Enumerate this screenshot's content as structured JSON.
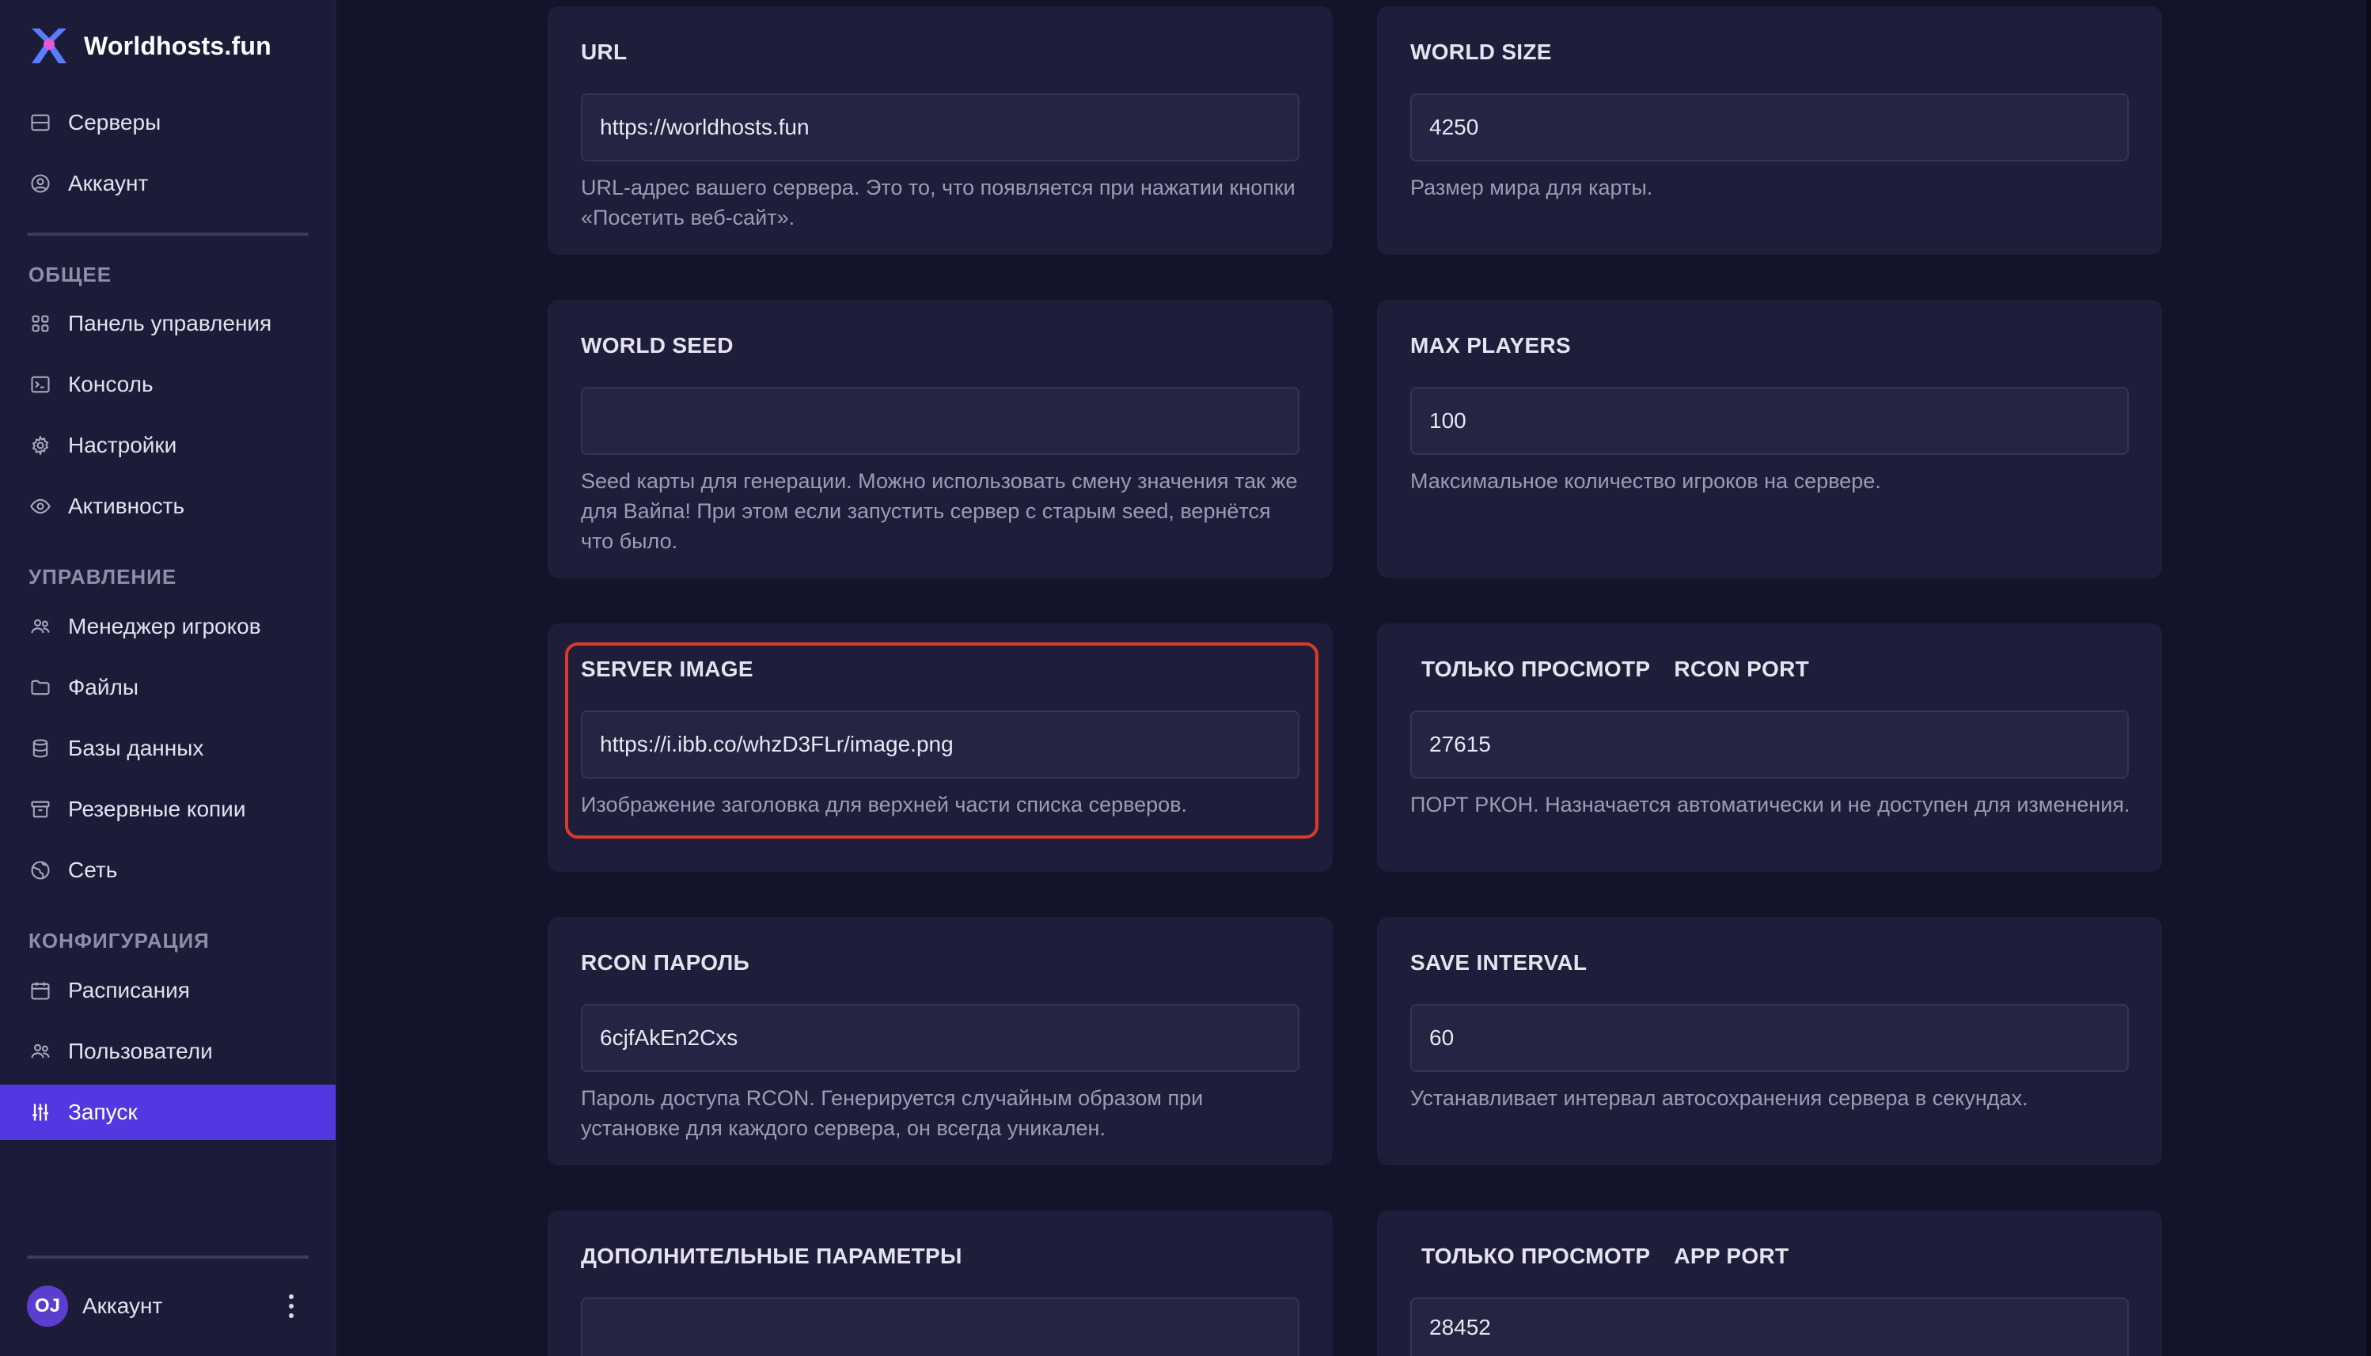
{
  "sidebar": {
    "brand": "Worldhosts.fun",
    "top_items": [
      {
        "label": "Серверы",
        "icon": "server-icon"
      },
      {
        "label": "Аккаунт",
        "icon": "user-circle-icon"
      }
    ],
    "sections": [
      {
        "title": "ОБЩЕЕ",
        "items": [
          {
            "label": "Панель управления",
            "icon": "grid-icon"
          },
          {
            "label": "Консоль",
            "icon": "terminal-icon"
          },
          {
            "label": "Настройки",
            "icon": "gear-icon"
          },
          {
            "label": "Активность",
            "icon": "eye-icon"
          }
        ]
      },
      {
        "title": "УПРАВЛЕНИЕ",
        "items": [
          {
            "label": "Менеджер игроков",
            "icon": "users-icon"
          },
          {
            "label": "Файлы",
            "icon": "folder-icon"
          },
          {
            "label": "Базы данных",
            "icon": "database-icon"
          },
          {
            "label": "Резервные копии",
            "icon": "archive-icon"
          },
          {
            "label": "Сеть",
            "icon": "globe-icon"
          }
        ]
      },
      {
        "title": "КОНФИГУРАЦИЯ",
        "items": [
          {
            "label": "Расписания",
            "icon": "calendar-icon"
          },
          {
            "label": "Пользователи",
            "icon": "users-icon"
          },
          {
            "label": "Запуск",
            "icon": "sliders-icon",
            "active": true
          }
        ]
      }
    ],
    "account": {
      "initials": "OJ",
      "label": "Аккаунт"
    }
  },
  "cards": {
    "url": {
      "title": "URL",
      "value": "https://worldhosts.fun",
      "help": "URL-адрес вашего сервера. Это то, что появляется при нажатии кнопки «Посетить веб-сайт»."
    },
    "world_size": {
      "title": "WORLD SIZE",
      "value": "4250",
      "help": "Размер мира для карты."
    },
    "world_seed": {
      "title": "WORLD SEED",
      "value": "",
      "help": "Seed карты для генерации. Можно использовать смену значения так же для Вайпа! При этом если запустить сервер с старым seed, вернётся что было."
    },
    "max_players": {
      "title": "MAX PLAYERS",
      "value": "100",
      "help": "Максимальное количество игроков на сервере."
    },
    "server_image": {
      "title": "SERVER IMAGE",
      "value": "https://i.ibb.co/whzD3FLr/image.png",
      "help": "Изображение заголовка для верхней части списка серверов."
    },
    "rcon_port": {
      "badge": "ТОЛЬКО ПРОСМОТР",
      "title": "RCON PORT",
      "value": "27615",
      "help": "ПОРТ РКОН. Назначается автоматически и не доступен для изменения."
    },
    "rcon_password": {
      "title": "RCON ПАРОЛЬ",
      "value": "6cjfAkEn2Cxs",
      "help": "Пароль доступа RCON. Генерируется случайным образом при установке для каждого сервера, он всегда уникален."
    },
    "save_interval": {
      "title": "SAVE INTERVAL",
      "value": "60",
      "help": "Устанавливает интервал автосохранения сервера в секундах."
    },
    "extra_params": {
      "title": "ДОПОЛНИТЕЛЬНЫЕ ПАРАМЕТРЫ",
      "value": ""
    },
    "app_port": {
      "badge": "ТОЛЬКО ПРОСМОТР",
      "title": "APP PORT",
      "value": "28452"
    }
  },
  "colors": {
    "accent": "#5238e0",
    "highlight": "#d93a2b",
    "background": "#13132a",
    "card": "#1e1e3a"
  }
}
